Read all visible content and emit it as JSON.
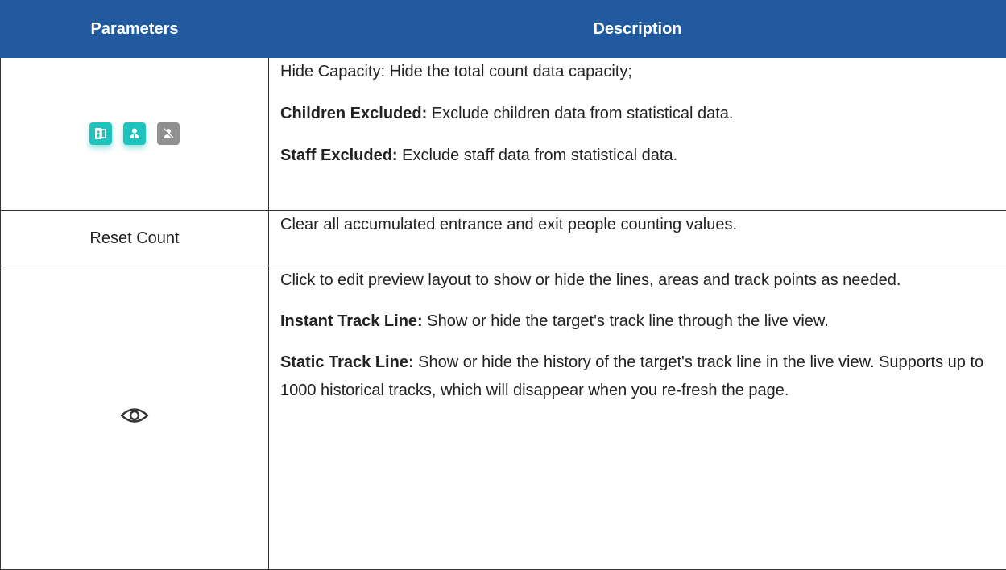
{
  "header": {
    "parameters_label": "Parameters",
    "description_label": "Description"
  },
  "rows": [
    {
      "icons": [
        "capacity-icon",
        "children-excluded-icon",
        "staff-excluded-icon"
      ],
      "lines": [
        {
          "bold": "",
          "text": "Hide Capacity: Hide the total count data capacity;"
        },
        {
          "bold": "Children Excluded:",
          "text": " Exclude children data from statistical data."
        },
        {
          "bold": "Staff Excluded:",
          "text": " Exclude staff data from statistical data."
        }
      ]
    },
    {
      "parameter": "Reset Count",
      "lines": [
        {
          "bold": "",
          "text": "Clear all accumulated entrance and exit people counting values."
        }
      ]
    },
    {
      "icons": [
        "eye-icon"
      ],
      "lines": [
        {
          "bold": "",
          "text": "Click to edit preview layout to show or hide the lines, areas and track points as needed."
        },
        {
          "bold": "Instant Track Line:",
          "text": " Show or hide the target's track line through the live view."
        },
        {
          "bold": "Static Track Line:",
          "text": " Show or hide the history of the target's track line in the live view. Supports up to 1000 historical tracks, which will disappear when you re-fresh the page."
        }
      ]
    }
  ],
  "colors": {
    "header_bg": "#215a9e",
    "header_text": "#ffffff",
    "icon_teal": "#1fc3bd",
    "icon_grey": "#8f8f8f"
  }
}
